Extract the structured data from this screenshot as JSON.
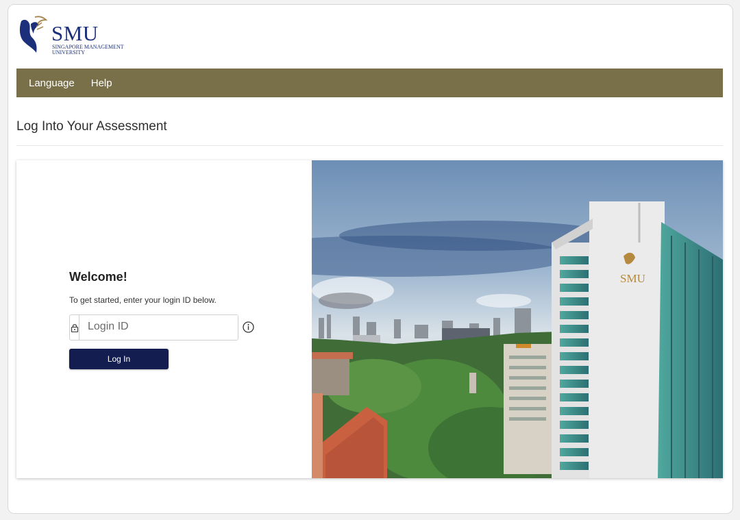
{
  "logo": {
    "wordmark": "SMU",
    "subtitle_line1": "Singapore Management",
    "subtitle_line2": "University"
  },
  "nav": {
    "items": [
      {
        "label": "Language"
      },
      {
        "label": "Help"
      }
    ]
  },
  "page": {
    "title": "Log Into Your Assessment"
  },
  "login": {
    "welcome": "Welcome!",
    "instructions": "To get started, enter your login ID below.",
    "input_placeholder": "Login ID",
    "input_value": "",
    "button_label": "Log In"
  },
  "hero_image": {
    "building_sign": "SMU"
  },
  "colors": {
    "nav_bar": "#79704a",
    "primary_button": "#141d4f",
    "brand_blue": "#1b2f7a"
  }
}
